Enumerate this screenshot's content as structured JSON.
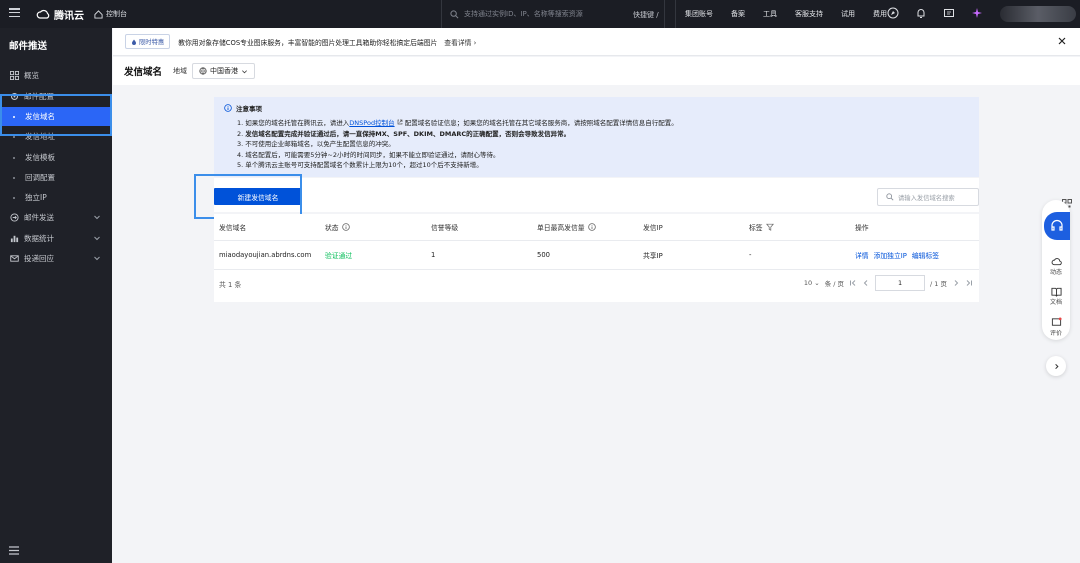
{
  "topbar": {
    "brand": "腾讯云",
    "console": "控制台",
    "search_placeholder": "支持通过实例ID、IP、名称等搜索资源",
    "shortcut": "快捷键 /",
    "nav": [
      "集团账号",
      "备案",
      "工具",
      "客服支持",
      "试用",
      "费用"
    ]
  },
  "sidebar": {
    "title": "邮件推送",
    "items": [
      {
        "label": "概览",
        "icon": "grid-icon"
      },
      {
        "label": "邮件配置",
        "icon": "gear-icon"
      },
      {
        "label": "发信域名",
        "active": true
      },
      {
        "label": "发信地址"
      },
      {
        "label": "发信模板"
      },
      {
        "label": "回调配置"
      },
      {
        "label": "独立IP"
      },
      {
        "label": "邮件发送",
        "icon": "send-icon"
      },
      {
        "label": "数据统计",
        "icon": "chart-icon"
      },
      {
        "label": "投递回应",
        "icon": "mail-icon"
      }
    ]
  },
  "notice": {
    "badge": "限时特惠",
    "text": "教你用对象存储COS专业图床服务，丰富智能的图片处理工具箱助你轻松搞定后端图片",
    "more": "查看详情"
  },
  "page": {
    "title": "发信域名",
    "region_label": "地域",
    "region_value": "中国香港"
  },
  "tips": {
    "title": "注意事项",
    "items": [
      {
        "pre": "1. 如果您的域名托管在腾讯云，请进入",
        "link": "DNSPod控制台",
        "post": "配置域名验证信息；如果您的域名托管在其它域名服务商，请按照域名配置详情信息自行配置。"
      },
      {
        "pre": "2. ",
        "bold": "发信域名配置完成并验证通过后，请一直保持MX、SPF、DKIM、DMARC的正确配置，否则会导致发信异常。",
        "post": ""
      },
      {
        "pre": "3. 不可使用企业邮箱域名，以免产生配置信息的冲突。",
        "post": ""
      },
      {
        "pre": "4. 域名配置后，可能需要5分钟~2小时的时间同步，如果不能立即验证通过，请耐心等待。",
        "post": ""
      },
      {
        "pre": "5. 单个腾讯云主账号可支持配置域名个数累计上限为10个，超过10个后不支持新增。",
        "post": ""
      }
    ]
  },
  "actions": {
    "create": "新建发信域名",
    "search_placeholder": "请输入发信域名搜索"
  },
  "table": {
    "columns": [
      "发信域名",
      "状态",
      "信誉等级",
      "单日最高发信量",
      "发信IP",
      "标签",
      "操作"
    ],
    "rows": [
      {
        "domain": "miaodayoujian.abrdns.com",
        "status": "验证通过",
        "reputation": "1",
        "daily_max": "500",
        "ip": "共享IP",
        "tag": "-",
        "ops": [
          "详情",
          "添加独立IP",
          "编辑标签"
        ]
      }
    ],
    "total": "共 1 条",
    "page_size": "10",
    "page_size_unit": "条 / 页",
    "current_page": "1",
    "page_total": "/ 1 页"
  },
  "rail": {
    "items": [
      "动态",
      "文档",
      "评价"
    ]
  },
  "colors": {
    "primary": "#0052d9",
    "sidebar_active": "#2b66f6",
    "success": "#0abf5b",
    "highlight_box": "#3b8eea"
  }
}
